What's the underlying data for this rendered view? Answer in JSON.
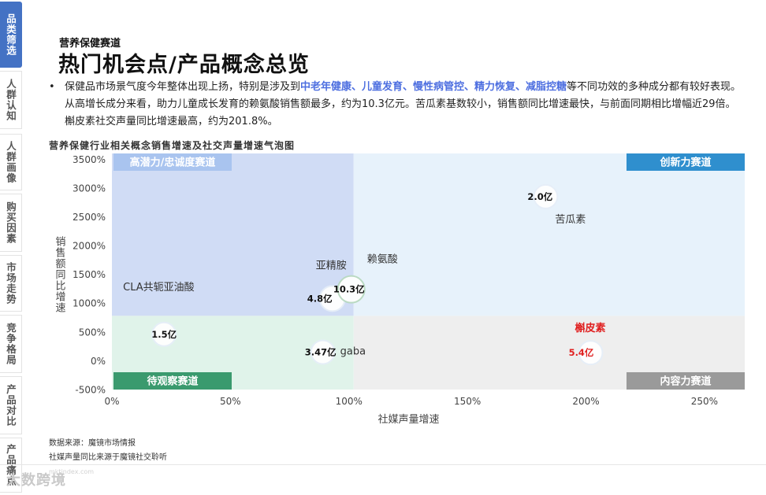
{
  "sidebar": {
    "tabs": [
      {
        "label": "品类筛选",
        "active": true
      },
      {
        "label": "人群认知",
        "active": false
      },
      {
        "label": "人群画像",
        "active": false
      },
      {
        "label": "购买因素",
        "active": false
      },
      {
        "label": "市场走势",
        "active": false
      },
      {
        "label": "竞争格局",
        "active": false
      },
      {
        "label": "产品对比",
        "active": false
      },
      {
        "label": "产品痛点",
        "active": false
      }
    ]
  },
  "header": {
    "eyebrow": "营养保健赛道",
    "title": "热门机会点/产品概念总览"
  },
  "summary": {
    "bullet": "•",
    "before": "保健品市场景气度今年整体出现上扬，特别是涉及到",
    "highlight": "中老年健康、儿童发育、慢性病管控、精力恢复、减脂控糖",
    "after": "等不同功效的多种成分都有较好表现。从高增长成分来看，助力儿童成长发育的赖氨酸销售额最多，约为10.3亿元。苦瓜素基数较小，销售额同比增速最快，与前面同期相比增幅近29倍。槲皮素社交声量同比增速最高，约为201.8%。",
    "highlight_color": "#4e6fe0"
  },
  "chart_title": "营养保健行业相关概念销售增速及社交声量增速气泡图",
  "chart_data": {
    "type": "scatter",
    "subtype": "bubble",
    "title": "营养保健行业相关概念销售增速及社交声量增速气泡图",
    "xlabel": "社媒声量增速",
    "ylabel": "销售额同比增速",
    "xlim": [
      0,
      2.67
    ],
    "ylim": [
      -500,
      3600
    ],
    "x_ticks": [
      0,
      0.5,
      1.0,
      1.5,
      2.0,
      2.5
    ],
    "x_tick_labels": [
      "0%",
      "50%",
      "100%",
      "150%",
      "200%",
      "250%"
    ],
    "y_ticks": [
      -500,
      0,
      500,
      1000,
      1500,
      2000,
      2500,
      3000,
      3500
    ],
    "y_tick_labels": [
      "-500%",
      "0%",
      "500%",
      "1000%",
      "1500%",
      "2000%",
      "2500%",
      "3000%",
      "3500%"
    ],
    "x_divider": 1.02,
    "y_divider": 780,
    "grid": false,
    "quadrants": [
      {
        "label": "高潜力/忠诚度赛道",
        "position": "top-left",
        "fill": "#d0dcf5",
        "label_bg": "#a9c4ef",
        "label_color": "#ffffff"
      },
      {
        "label": "创新力赛道",
        "position": "top-right",
        "fill": "#e7f2fb",
        "label_bg": "#2f8fce",
        "label_color": "#ffffff"
      },
      {
        "label": "待观察赛道",
        "position": "bottom-left",
        "fill": "#e0f3ea",
        "label_bg": "#3a9a6e",
        "label_color": "#ffffff"
      },
      {
        "label": "内容力赛道",
        "position": "bottom-right",
        "fill": "#eeeeee",
        "label_bg": "#9a9a9a",
        "label_color": "#ffffff"
      }
    ],
    "points": [
      {
        "name": "CLA共轭亚油酸",
        "x": 0.22,
        "y": 460,
        "value_label": "1.5亿",
        "value_color": "#111111",
        "name_color": "#333333"
      },
      {
        "name": "亚精胺",
        "x": 0.93,
        "y": 1080,
        "value_label": "4.8亿",
        "value_color": "#111111",
        "name_color": "#333333"
      },
      {
        "name": "赖氨酸",
        "x": 1.01,
        "y": 1240,
        "value_label": "10.3亿",
        "value_color": "#111111",
        "name_color": "#333333"
      },
      {
        "name": "gaba",
        "x": 0.89,
        "y": 150,
        "value_label": "3.47亿",
        "value_color": "#111111",
        "name_color": "#333333"
      },
      {
        "name": "苦瓜素",
        "x": 1.83,
        "y": 2850,
        "value_label": "2.0亿",
        "value_color": "#111111",
        "name_color": "#333333"
      },
      {
        "name": "槲皮素",
        "x": 2.02,
        "y": 140,
        "value_label": "5.4亿",
        "value_color": "#e02020",
        "name_color": "#e02020"
      }
    ]
  },
  "footer": {
    "source_1": "数据来源：魔镜市场情报",
    "source_2": "社媒声量同比来源于魔镜社交聆听",
    "watermark": "大数跨境",
    "watermark_url": "mktindex.com"
  }
}
